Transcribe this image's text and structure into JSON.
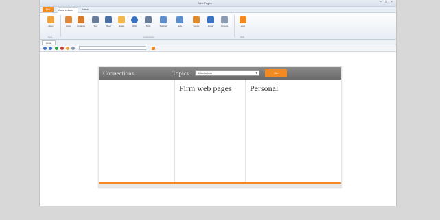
{
  "window": {
    "title": "Web Pages",
    "controls": [
      "–",
      "□",
      "×"
    ]
  },
  "app_tab": {
    "label": "File"
  },
  "ribbon_tabs": [
    {
      "label": "Connections"
    },
    {
      "label": "View"
    }
  ],
  "ribbon": {
    "buttons": [
      {
        "label": "Open",
        "icon": "folder-icon",
        "color": "#f2a23a"
      },
      {
        "label": "Users",
        "icon": "user-icon",
        "color": "#e0883a"
      },
      {
        "label": "Contacts",
        "icon": "contacts-icon",
        "color": "#d97a2b"
      },
      {
        "label": "Text",
        "icon": "text-icon",
        "color": "#6a7d9a"
      },
      {
        "label": "Chart",
        "icon": "chart-icon",
        "color": "#4a6fa5"
      },
      {
        "label": "Notes",
        "icon": "note-icon",
        "color": "#f2b84b"
      },
      {
        "label": "Web",
        "icon": "globe-icon",
        "color": "#3b74c4"
      },
      {
        "label": "Tools",
        "icon": "tools-icon",
        "color": "#6a7d9a"
      },
      {
        "label": "Settings",
        "icon": "settings-icon",
        "color": "#5e8fcf"
      },
      {
        "label": "Edit",
        "icon": "edit-icon",
        "color": "#5e8fcf"
      },
      {
        "label": "Export",
        "icon": "export-icon",
        "color": "#e08a2a"
      },
      {
        "label": "Import",
        "icon": "import-icon",
        "color": "#3b74c4"
      },
      {
        "label": "Options",
        "icon": "options-icon",
        "color": "#8a9ab0"
      },
      {
        "label": "Help",
        "icon": "help-icon",
        "color": "#f28a1f"
      }
    ],
    "groups": [
      {
        "label": "New"
      },
      {
        "label": "Connections"
      },
      {
        "label": "Help"
      }
    ]
  },
  "doc_tab": {
    "label": "Home"
  },
  "nav": {
    "address_value": "",
    "address_placeholder": "Address"
  },
  "page": {
    "brand": "Connections",
    "topics_label": "Topics",
    "topic_select_value": "Select a topic",
    "go_label": "Go",
    "description": "",
    "columns": [
      {
        "heading": "Firm web pages",
        "links": [
          "",
          "",
          "",
          ""
        ]
      },
      {
        "heading": "Personal",
        "links": [
          "",
          "",
          "",
          "",
          ""
        ]
      }
    ]
  },
  "colors": {
    "accent": "#f28a1f",
    "header_bg": "#7a7a7a",
    "frame": "#d8d8d8"
  }
}
